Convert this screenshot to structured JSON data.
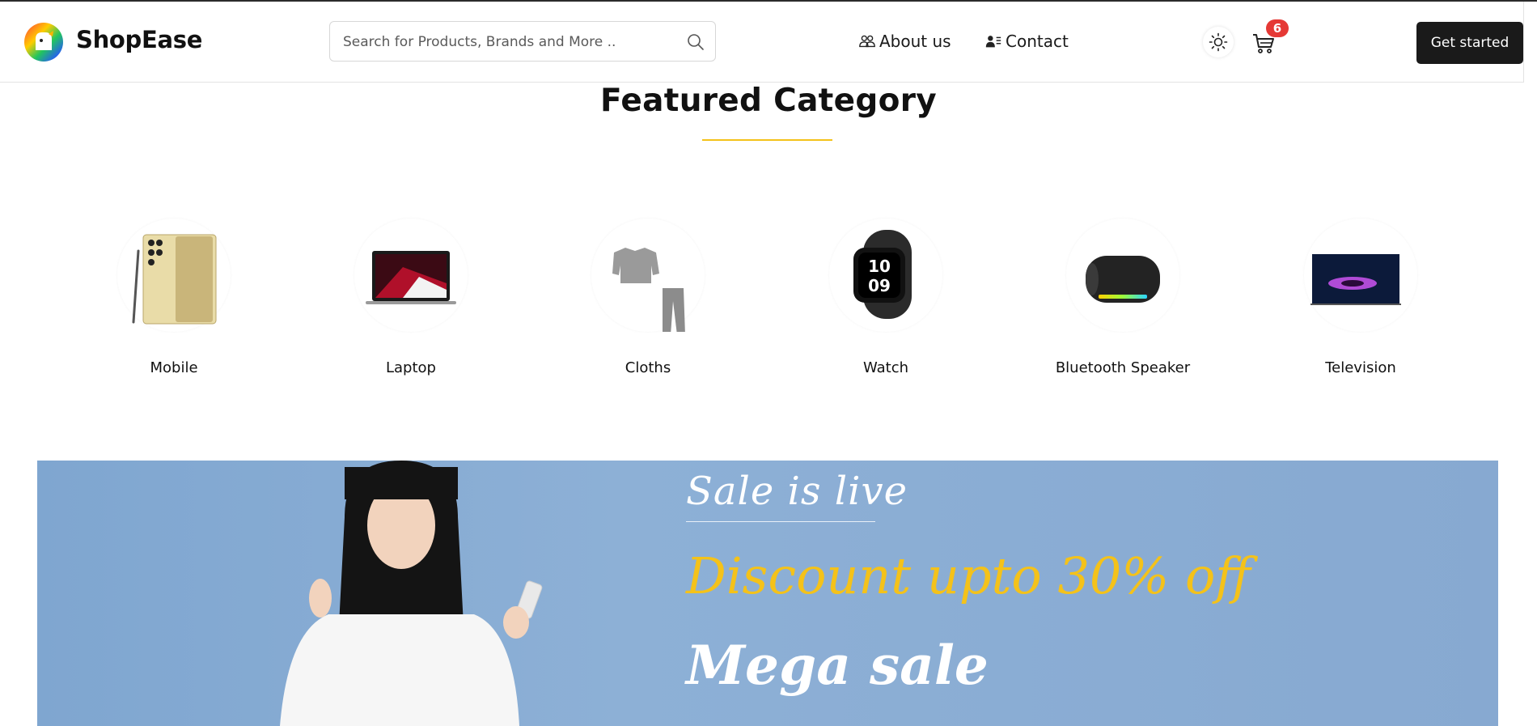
{
  "header": {
    "brand": "ShopEase",
    "search_placeholder": "Search for Products, Brands and More ..",
    "nav": [
      {
        "label": "About us",
        "icon": "users-icon"
      },
      {
        "label": "Contact",
        "icon": "contact-card-icon"
      }
    ],
    "theme_icon": "sun-icon",
    "cart_count": "6",
    "cta_label": "Get started"
  },
  "featured": {
    "title": "Featured Category",
    "categories": [
      {
        "label": "Mobile",
        "icon": "smartphone-icon"
      },
      {
        "label": "Laptop",
        "icon": "laptop-icon"
      },
      {
        "label": "Cloths",
        "icon": "clothes-icon"
      },
      {
        "label": "Watch",
        "icon": "smartwatch-icon"
      },
      {
        "label": "Bluetooth Speaker",
        "icon": "speaker-icon"
      },
      {
        "label": "Television",
        "icon": "television-icon"
      }
    ]
  },
  "banner": {
    "line1": "Sale is live",
    "line2": "Discount upto 30% off",
    "line3": "Mega sale"
  },
  "colors": {
    "accent": "#f4c21a",
    "badge": "#e53935",
    "cta_bg": "#1a1a1a",
    "banner_bg": "#87a9d1"
  }
}
